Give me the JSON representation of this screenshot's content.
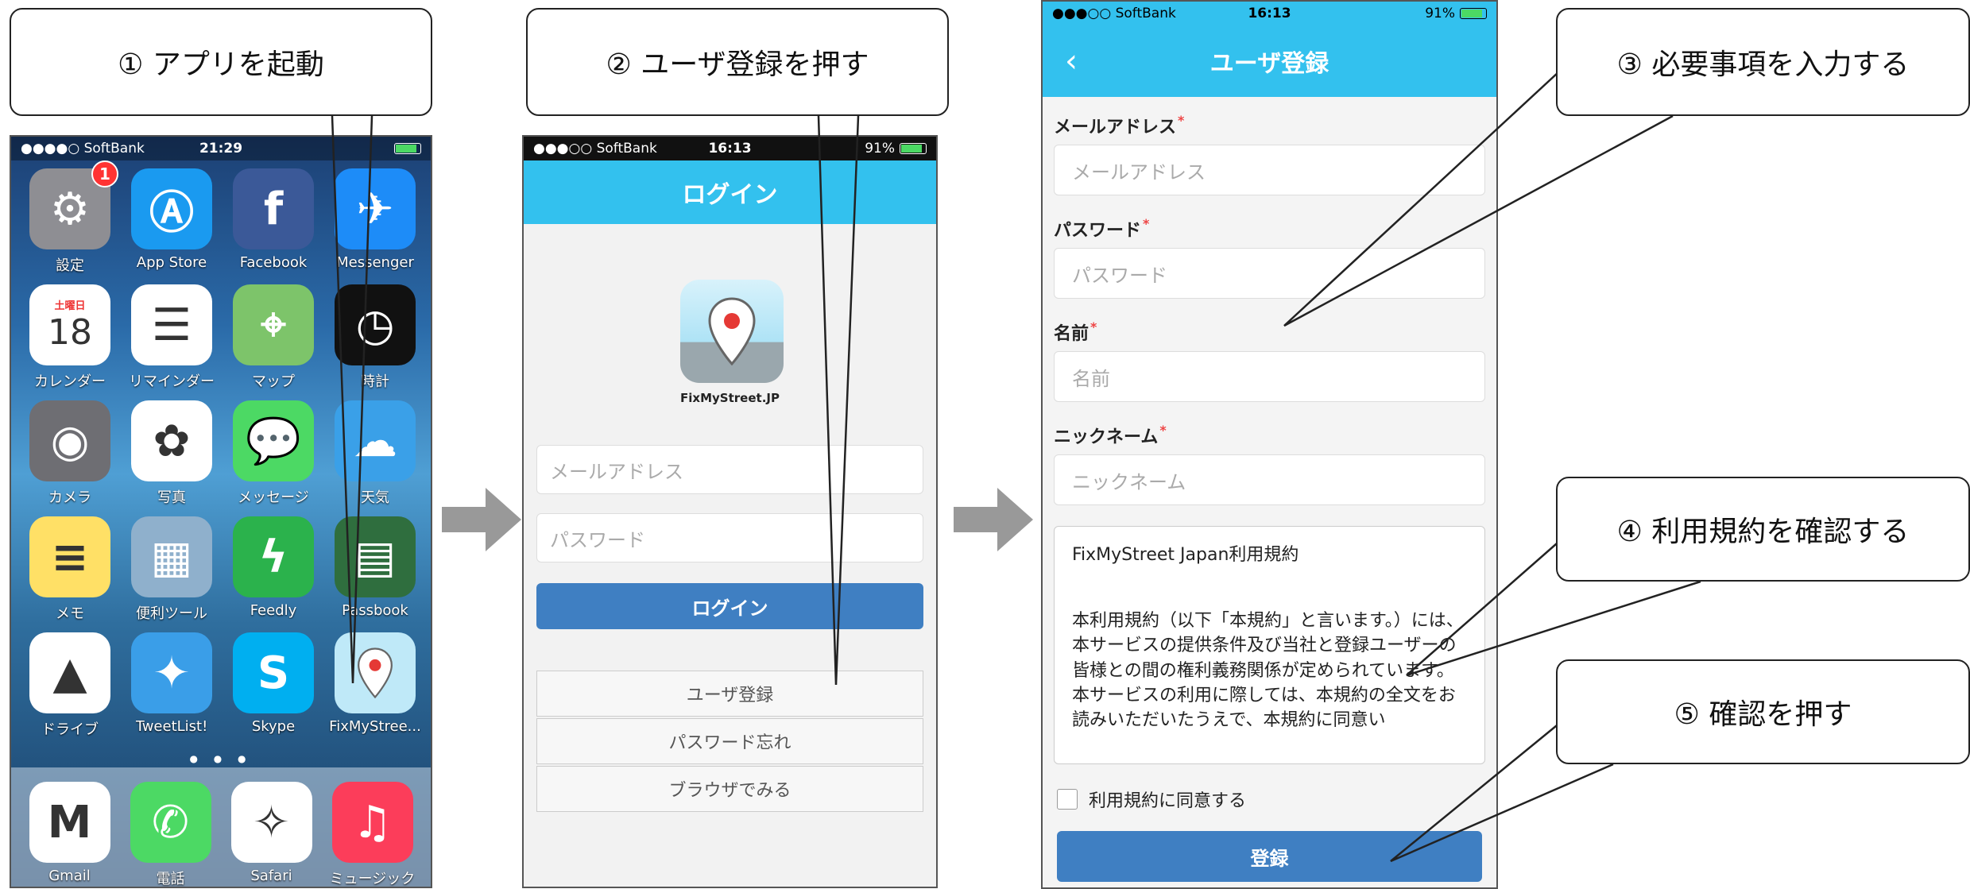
{
  "callouts": {
    "c1": "① アプリを起動",
    "c2": "② ユーザ登録を押す",
    "c3": "③ 必要事項を入力する",
    "c4": "④ 利用規約を確認する",
    "c5": "⑤ 確認を押す"
  },
  "home": {
    "status": {
      "carrier": "●●●●○ SoftBank",
      "time": "21:29"
    },
    "apps": [
      {
        "label": "設定",
        "icon": "gear-icon",
        "badge": "1",
        "color": "#8e8e93"
      },
      {
        "label": "App Store",
        "icon": "app-store-icon",
        "color": "#1a9af0"
      },
      {
        "label": "Facebook",
        "icon": "facebook-icon",
        "color": "#3b5998"
      },
      {
        "label": "Messenger",
        "icon": "messenger-icon",
        "color": "#1d8cf8"
      },
      {
        "label": "カレンダー",
        "icon": "calendar-icon",
        "color": "#ffffff",
        "day": "土曜日",
        "date": "18"
      },
      {
        "label": "リマインダー",
        "icon": "reminders-icon",
        "color": "#ffffff"
      },
      {
        "label": "マップ",
        "icon": "maps-icon",
        "color": "#7dc46a"
      },
      {
        "label": "時計",
        "icon": "clock-icon",
        "color": "#111111"
      },
      {
        "label": "カメラ",
        "icon": "camera-icon",
        "color": "#6e6e73"
      },
      {
        "label": "写真",
        "icon": "photos-icon",
        "color": "#ffffff"
      },
      {
        "label": "メッセージ",
        "icon": "messages-icon",
        "color": "#4cd964"
      },
      {
        "label": "天気",
        "icon": "weather-icon",
        "color": "#3aa0e8"
      },
      {
        "label": "メモ",
        "icon": "notes-icon",
        "color": "#ffe066"
      },
      {
        "label": "便利ツール",
        "icon": "folder-icon",
        "color": "#8fb0cc"
      },
      {
        "label": "Feedly",
        "icon": "feedly-icon",
        "color": "#2bb24c"
      },
      {
        "label": "Passbook",
        "icon": "passbook-icon",
        "color": "#2f6e3e"
      },
      {
        "label": "ドライブ",
        "icon": "drive-icon",
        "color": "#ffffff"
      },
      {
        "label": "TweetList!",
        "icon": "tweetlist-icon",
        "color": "#3a9ee8"
      },
      {
        "label": "Skype",
        "icon": "skype-icon",
        "color": "#00aff0"
      },
      {
        "label": "FixMyStree...",
        "icon": "fixmystreet-icon",
        "color": "#bfe9f8"
      }
    ],
    "dock": [
      {
        "label": "Gmail",
        "icon": "gmail-icon",
        "color": "#ffffff"
      },
      {
        "label": "電話",
        "icon": "phone-icon",
        "color": "#4cd964"
      },
      {
        "label": "Safari",
        "icon": "safari-icon",
        "color": "#ffffff"
      },
      {
        "label": "ミュージック",
        "icon": "music-icon",
        "color": "#fc3d5a"
      }
    ]
  },
  "login": {
    "status": {
      "carrier": "●●●○○ SoftBank",
      "time": "16:13",
      "battery": "91%"
    },
    "title": "ログイン",
    "logo_text": "FixMyStreet.JP",
    "email_placeholder": "メールアドレス",
    "password_placeholder": "パスワード",
    "login_button": "ログイン",
    "register_button": "ユーザ登録",
    "forgot_button": "パスワード忘れ",
    "browse_button": "ブラウザでみる"
  },
  "register": {
    "status": {
      "carrier": "●●●○○ SoftBank",
      "time": "16:13",
      "battery": "91%"
    },
    "title": "ユーザ登録",
    "back": "‹",
    "fields": [
      {
        "label": "メールアドレス",
        "placeholder": "メールアドレス"
      },
      {
        "label": "パスワード",
        "placeholder": "パスワード"
      },
      {
        "label": "名前",
        "placeholder": "名前"
      },
      {
        "label": "ニックネーム",
        "placeholder": "ニックネーム"
      }
    ],
    "required_mark": "*",
    "terms_title": "FixMyStreet Japan利用規約",
    "terms_body": "本利用規約（以下「本規約」と言います。）には、本サービスの提供条件及び当社と登録ユーザーの皆様との間の権利義務関係が定められています。本サービスの利用に際しては、本規約の全文をお読みいただいたうえで、本規約に同意い",
    "agree_label": "利用規約に同意する",
    "submit_button": "登録"
  }
}
